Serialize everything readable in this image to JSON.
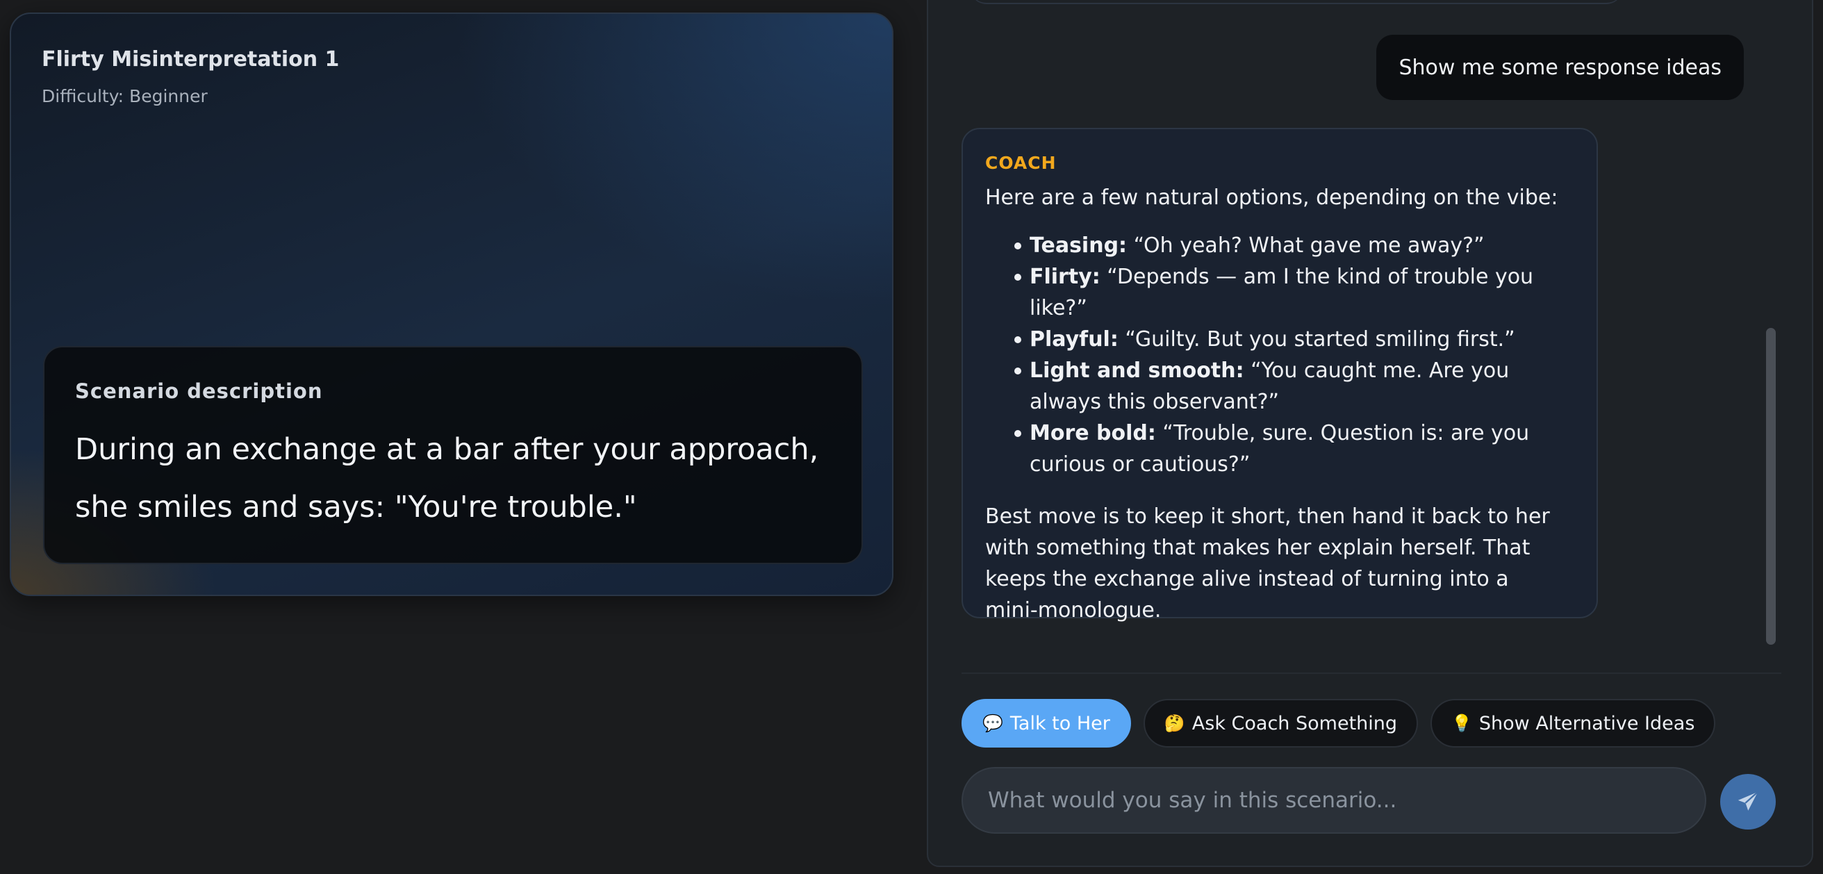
{
  "scenario": {
    "title": "Flirty Misinterpretation 1",
    "difficulty": "Difficulty: Beginner",
    "description_heading": "Scenario description",
    "description": "During an exchange at a bar after your approach, she smiles and says: \"You're trouble.\""
  },
  "chat": {
    "user_message": "Show me some response ideas",
    "coach": {
      "label": "COACH",
      "intro": "Here are a few natural options, depending on the vibe:",
      "options": [
        {
          "label": "Teasing:",
          "text": " “Oh yeah? What gave me away?”"
        },
        {
          "label": "Flirty:",
          "text": " “Depends — am I the kind of trouble you like?”"
        },
        {
          "label": "Playful:",
          "text": " “Guilty. But you started smiling first.”"
        },
        {
          "label": "Light and smooth:",
          "text": " “You caught me. Are you always this observant?”"
        },
        {
          "label": "More bold:",
          "text": " “Trouble, sure. Question is: are you curious or cautious?”"
        }
      ],
      "outro": "Best move is to keep it short, then hand it back to her with something that makes her explain herself. That keeps the exchange alive instead of turning into a mini-monologue."
    }
  },
  "actions": {
    "talk": {
      "emoji": "💬",
      "label": "Talk to Her"
    },
    "ask": {
      "emoji": "🤔",
      "label": "Ask Coach Something"
    },
    "ideas": {
      "emoji": "💡",
      "label": "Show Alternative Ideas"
    }
  },
  "input": {
    "placeholder": "What would you say in this scenario...",
    "value": ""
  },
  "colors": {
    "accent": "#5aa7f5",
    "coach_label": "#f2a81d",
    "send_button": "#3f6ea8"
  }
}
